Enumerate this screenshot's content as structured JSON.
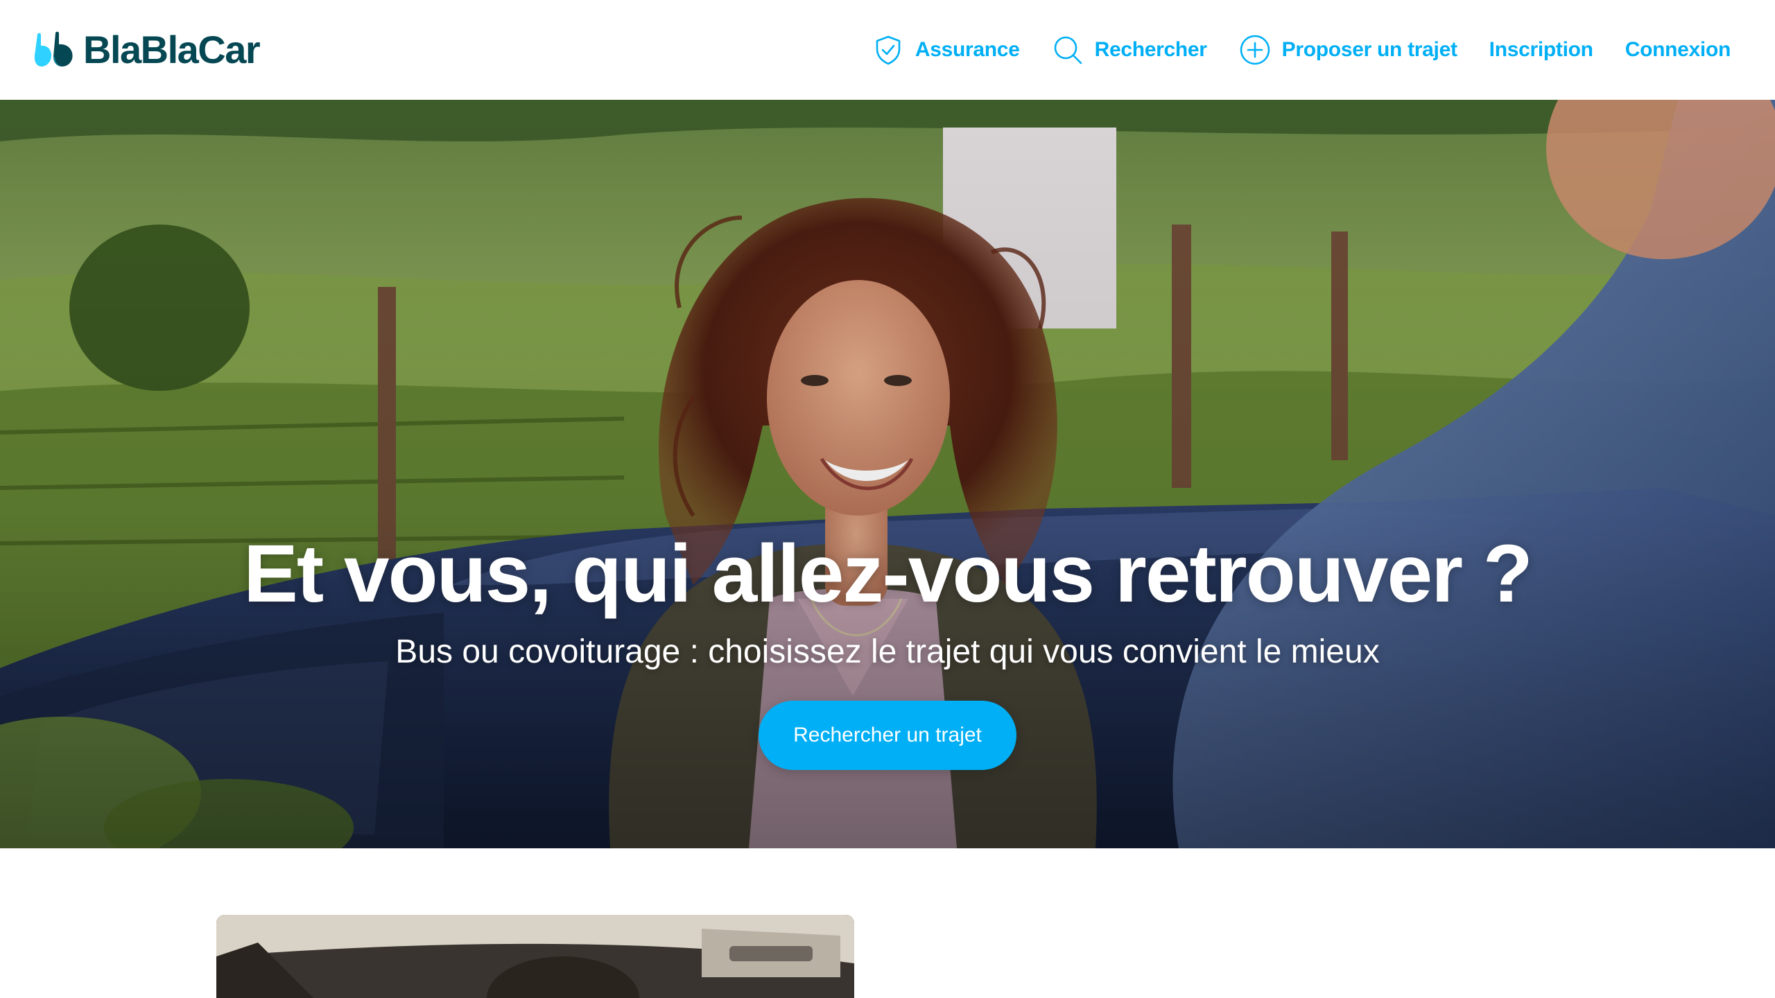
{
  "brand": {
    "name": "BlaBlaCar",
    "logo_icon": "blablacar-quote-mark-icon",
    "colors": {
      "primary": "#00aff5",
      "dark_teal": "#054752",
      "white": "#ffffff"
    }
  },
  "nav": {
    "items": [
      {
        "label": "Assurance",
        "icon": "shield-check-icon"
      },
      {
        "label": "Rechercher",
        "icon": "search-icon"
      },
      {
        "label": "Proposer un trajet",
        "icon": "plus-circle-icon"
      },
      {
        "label": "Inscription"
      },
      {
        "label": "Connexion"
      }
    ]
  },
  "hero": {
    "title": "Et vous, qui allez-vous retrouver ?",
    "subtitle": "Bus ou covoiturage : choisissez le trajet qui vous convient le mieux",
    "cta_label": "Rechercher un trajet"
  }
}
